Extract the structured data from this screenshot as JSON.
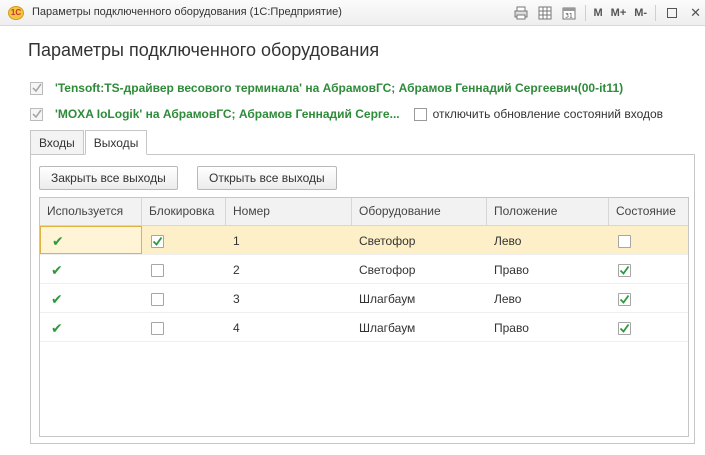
{
  "window": {
    "title": "Параметры подключенного оборудования (1С:Предприятие)",
    "logo_text": "1С",
    "toolbar": [
      "M",
      "M+",
      "M-"
    ],
    "icons": [
      "print-icon",
      "table-icon",
      "calendar-icon",
      "maximize-icon",
      "close-icon"
    ]
  },
  "form": {
    "title": "Параметры подключенного оборудования"
  },
  "equipment": [
    {
      "label": "'Tensoft:TS-драйвер весового терминала' на АбрамовГС; Абрамов Геннадий Сергеевич(00-it11)",
      "checked": true
    },
    {
      "label": "'MOXA IoLogik' на АбрамовГС; Абрамов Геннадий Серге...",
      "checked": true
    }
  ],
  "option_disable_inputs": {
    "label": "отключить обновление состояний входов",
    "checked": false
  },
  "tabs": [
    {
      "label": "Входы",
      "active": false
    },
    {
      "label": "Выходы",
      "active": true
    }
  ],
  "buttons": {
    "close_all": "Закрыть все выходы",
    "open_all": "Открыть все выходы"
  },
  "table": {
    "columns": [
      "Используется",
      "Блокировка",
      "Номер",
      "Оборудование",
      "Положение",
      "Состояние"
    ],
    "rows": [
      {
        "used": true,
        "blocked": true,
        "number": "1",
        "equipment": "Светофор",
        "position": "Лево",
        "state": false
      },
      {
        "used": true,
        "blocked": false,
        "number": "2",
        "equipment": "Светофор",
        "position": "Право",
        "state": true
      },
      {
        "used": true,
        "blocked": false,
        "number": "3",
        "equipment": "Шлагбаум",
        "position": "Лево",
        "state": true
      },
      {
        "used": true,
        "blocked": false,
        "number": "4",
        "equipment": "Шлагбаум",
        "position": "Право",
        "state": true
      }
    ],
    "selected_row": 0
  },
  "colors": {
    "accent_green": "#2e8b3a",
    "selection": "#fdf0c8"
  }
}
